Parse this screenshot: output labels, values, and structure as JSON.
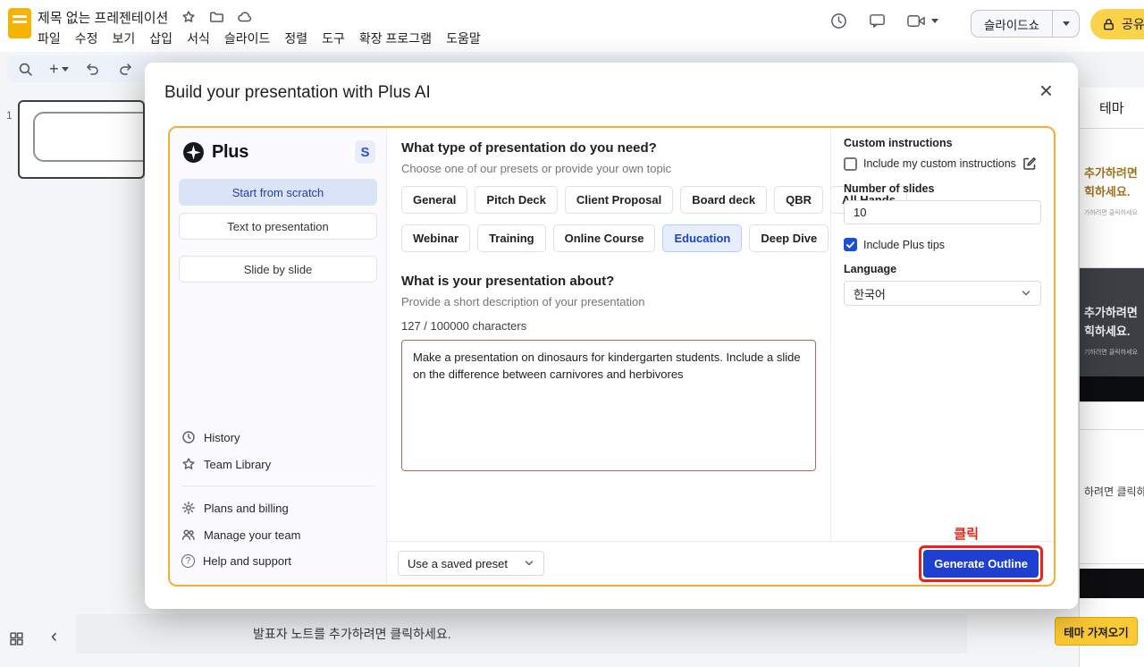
{
  "colors": {
    "dialog_border_yellow": "#f2b033",
    "annotation_red": "#e5261d",
    "generate_button_blue": "#1e3fd0",
    "selected_chip_bg": "#e6edfd",
    "selected_chip_text": "#1b44c8",
    "share_button_yellow": "#fbd34b",
    "import_theme_yellow": "#fcc934",
    "checkbox_checked_blue": "#1d4ed8",
    "slides_logo_yellow": "#f4b400"
  },
  "slides_app": {
    "doc_title": "제목 없는 프레젠테이션",
    "menus": [
      "파일",
      "수정",
      "보기",
      "삽입",
      "서식",
      "슬라이드",
      "정렬",
      "도구",
      "확장 프로그램",
      "도움말"
    ],
    "slideshow_button": "슬라이드쇼",
    "share_button": "공유",
    "slide_number": "1",
    "speaker_notes_placeholder": "발표자 노트를 추가하려면 클릭하세요.",
    "theme_panel": {
      "title": "테마",
      "light_card": {
        "line1": "추가하려면",
        "line2": "힉하세요.",
        "caption": "가하려면 클릭하세요"
      },
      "dark_card": {
        "line1": "추가하려면",
        "line2": "힉하세요.",
        "caption": "기하려면 클릭하세요"
      },
      "plain_card": {
        "line1": "하려면 클릭하"
      },
      "import_button": "테마 가져오기"
    }
  },
  "dialog": {
    "title": "Build your presentation with Plus AI",
    "sidebar": {
      "brand": "Plus",
      "avatar": "S",
      "modes": [
        "Start from scratch",
        "Text to presentation",
        "Slide by slide"
      ],
      "links": [
        "History",
        "Team Library",
        "Plans and billing",
        "Manage your team",
        "Help and support"
      ]
    },
    "type_section": {
      "heading": "What type of presentation do you need?",
      "subheading": "Choose one of our presets or provide your own topic",
      "presets_row1": [
        "General",
        "Pitch Deck",
        "Client Proposal",
        "Board deck",
        "QBR",
        "All Hands"
      ],
      "presets_row2": [
        "Webinar",
        "Training",
        "Online Course",
        "Education",
        "Deep Dive"
      ],
      "selected_preset": "Education"
    },
    "about_section": {
      "heading": "What is your presentation about?",
      "subheading": "Provide a short description of your presentation",
      "char_count": "127 / 100000 characters",
      "description": "Make a presentation on dinosaurs for kindergarten students. Include a slide on the difference between carnivores and herbivores"
    },
    "options": {
      "custom_instructions_label": "Custom instructions",
      "include_custom": "Include my custom instructions",
      "number_of_slides_label": "Number of slides",
      "number_of_slides": "10",
      "include_tips": "Include Plus tips",
      "language_label": "Language",
      "language": "한국어"
    },
    "footer": {
      "preset_select": "Use a saved preset",
      "generate_button": "Generate Outline",
      "click_annotation": "클릭"
    }
  }
}
